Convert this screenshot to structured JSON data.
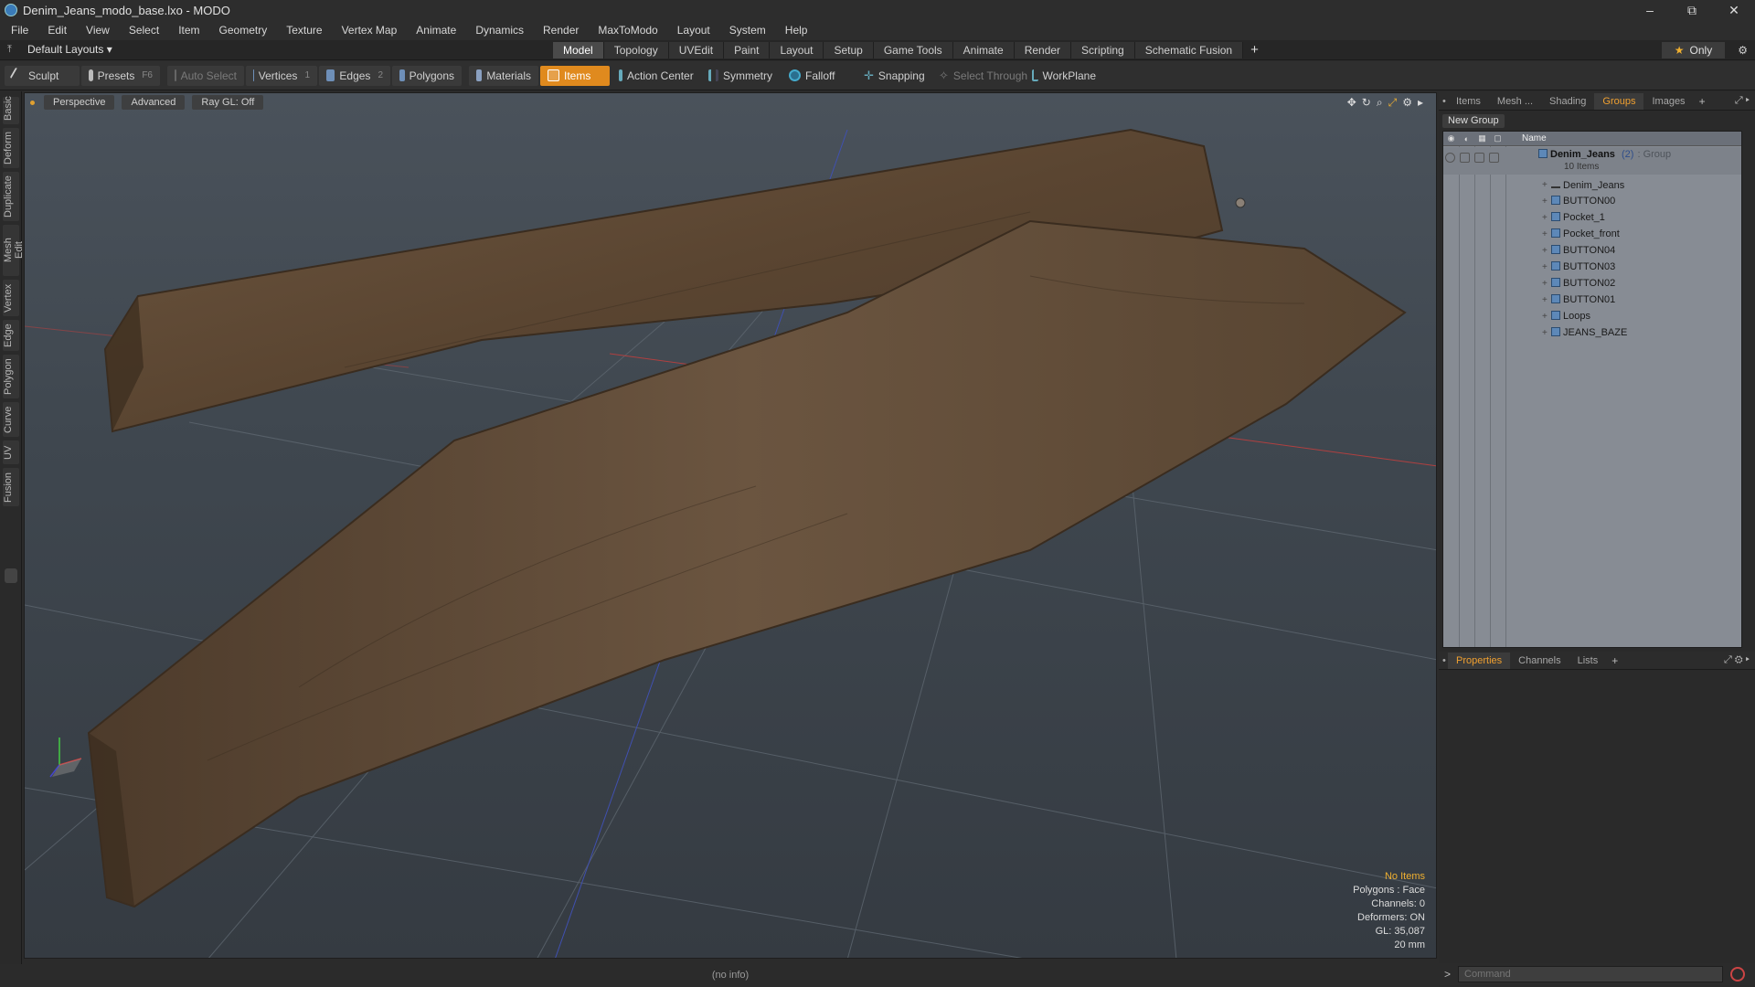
{
  "window": {
    "title": "Denim_Jeans_modo_base.lxo - MODO",
    "controls": [
      "–",
      "⧉",
      "✕"
    ]
  },
  "menu": [
    "File",
    "Edit",
    "View",
    "Select",
    "Item",
    "Geometry",
    "Texture",
    "Vertex Map",
    "Animate",
    "Dynamics",
    "Render",
    "MaxToModo",
    "Layout",
    "System",
    "Help"
  ],
  "layoutbar": {
    "layouts_label": "Default Layouts ▾",
    "tabs": [
      "Model",
      "Topology",
      "UVEdit",
      "Paint",
      "Layout",
      "Setup",
      "Game Tools",
      "Animate",
      "Render",
      "Scripting",
      "Schematic Fusion"
    ],
    "active_tab": "Model",
    "only_label": "Only"
  },
  "toolbar": {
    "sculpt": "Sculpt",
    "presets": "Presets",
    "presets_key": "F6",
    "auto_select": "Auto Select",
    "vertices": "Vertices",
    "vertices_num": "1",
    "edges": "Edges",
    "edges_num": "2",
    "polygons": "Polygons",
    "materials": "Materials",
    "items": "Items",
    "action_center": "Action Center",
    "symmetry": "Symmetry",
    "falloff": "Falloff",
    "snapping": "Snapping",
    "select_through": "Select Through",
    "workplane": "WorkPlane"
  },
  "left_tabs": [
    "Basic",
    "Deform",
    "Duplicate",
    "Mesh Edit",
    "Vertex",
    "Edge",
    "Polygon",
    "Curve",
    "UV",
    "Fusion"
  ],
  "viewport": {
    "view_mode": "Perspective",
    "shading": "Advanced",
    "raygl": "Ray GL: Off",
    "info": {
      "selection": "No Items",
      "polygons": "Polygons : Face",
      "channels": "Channels: 0",
      "deformers": "Deformers: ON",
      "gl": "GL: 35,087",
      "scale": "20 mm"
    },
    "status": "(no info)"
  },
  "right_panel": {
    "top_tabs": [
      "Items",
      "Mesh ...",
      "Shading",
      "Groups",
      "Images"
    ],
    "top_active": "Groups",
    "new_group": "New Group",
    "name_header": "Name",
    "group": {
      "name": "Denim_Jeans",
      "count": "(2)",
      "type": ": Group",
      "items_count": "10 Items"
    },
    "items": [
      "Denim_Jeans",
      "BUTTON00",
      "Pocket_1",
      "Pocket_front",
      "BUTTON04",
      "BUTTON03",
      "BUTTON02",
      "BUTTON01",
      "Loops",
      "JEANS_BAZE"
    ],
    "bottom_tabs": [
      "Properties",
      "Channels",
      "Lists"
    ],
    "bottom_active": "Properties"
  },
  "command": {
    "placeholder": "Command"
  },
  "colors": {
    "accent": "#e08a1e",
    "viewport_bg": "#3f474f",
    "denim": "#6b5238"
  }
}
